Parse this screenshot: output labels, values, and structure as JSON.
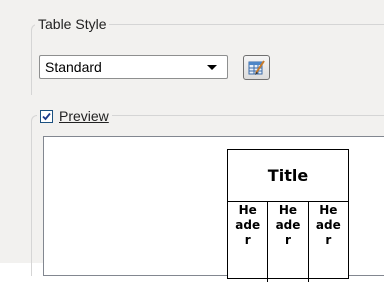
{
  "table_style": {
    "group_label": "Table Style",
    "selected": "Standard",
    "edit_button_icon": "table-style-edit-icon"
  },
  "preview": {
    "checkbox_label": "Preview",
    "checked": true,
    "sample_table": {
      "title": "Title",
      "header_cells": [
        {
          "line1": "He",
          "line2": "ade",
          "line3": "r"
        },
        {
          "line1": "He",
          "line2": "ade",
          "line3": "r"
        },
        {
          "line1": "He",
          "line2": "ade",
          "line3": "r"
        }
      ]
    }
  }
}
